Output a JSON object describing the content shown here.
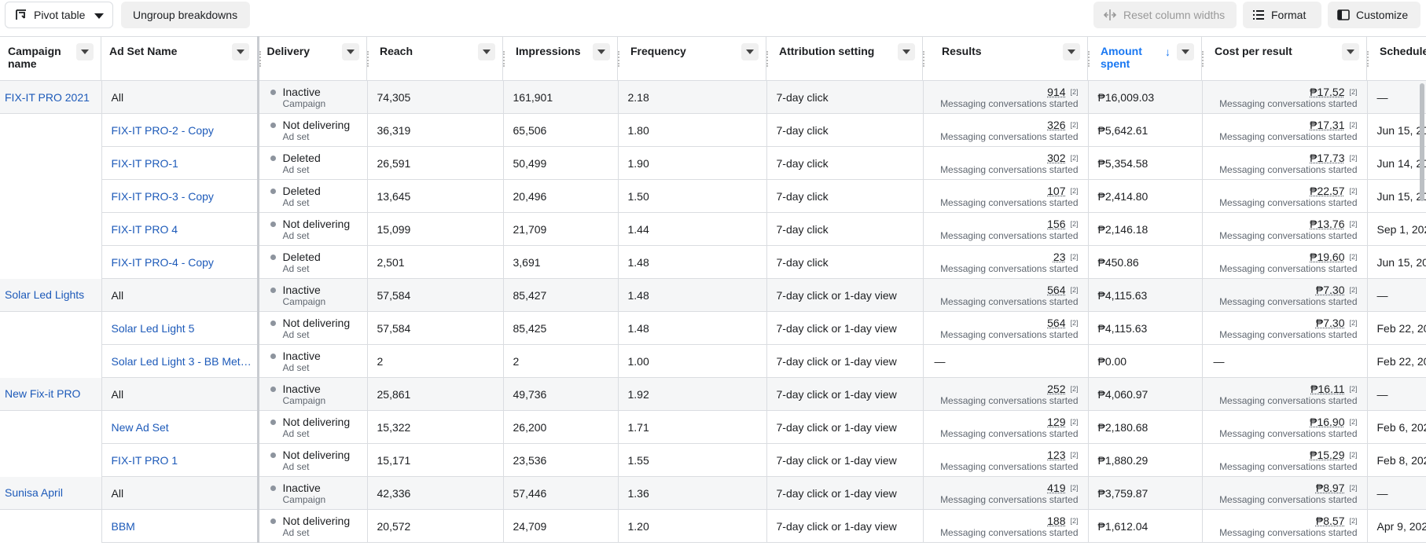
{
  "toolbar": {
    "pivot_label": "Pivot table",
    "ungroup_label": "Ungroup breakdowns",
    "reset_label": "Reset column widths",
    "format_label": "Format",
    "customize_label": "Customize"
  },
  "columns": {
    "campaign": "Campaign name",
    "adset": "Ad Set Name",
    "delivery": "Delivery",
    "reach": "Reach",
    "impressions": "Impressions",
    "frequency": "Frequency",
    "attribution": "Attribution setting",
    "results": "Results",
    "amount": "Amount spent",
    "cpr": "Cost per result",
    "schedule": "Schedule"
  },
  "footnote": "[2]",
  "rows": [
    {
      "campaign": "FIX-IT PRO 2021",
      "adset": "All",
      "d1": "Inactive",
      "d2": "Campaign",
      "reach": "74,305",
      "impr": "161,901",
      "freq": "2.18",
      "attr": "7-day click",
      "res": "914",
      "res_sub": "Messaging conversations started",
      "amt": "₱16,009.03",
      "cpr": "₱17.52",
      "cpr_sub": "Messaging conversations started",
      "sched": "—"
    },
    {
      "campaign": "",
      "adset": "FIX-IT PRO-2 - Copy",
      "d1": "Not delivering",
      "d2": "Ad set",
      "reach": "36,319",
      "impr": "65,506",
      "freq": "1.80",
      "attr": "7-day click",
      "res": "326",
      "res_sub": "Messaging conversations started",
      "amt": "₱5,642.61",
      "cpr": "₱17.31",
      "cpr_sub": "Messaging conversations started",
      "sched": "Jun 15, 20"
    },
    {
      "campaign": "",
      "adset": "FIX-IT PRO-1",
      "d1": "Deleted",
      "d2": "Ad set",
      "reach": "26,591",
      "impr": "50,499",
      "freq": "1.90",
      "attr": "7-day click",
      "res": "302",
      "res_sub": "Messaging conversations started",
      "amt": "₱5,354.58",
      "cpr": "₱17.73",
      "cpr_sub": "Messaging conversations started",
      "sched": "Jun 14, 20"
    },
    {
      "campaign": "",
      "adset": "FIX-IT PRO-3 - Copy",
      "d1": "Deleted",
      "d2": "Ad set",
      "reach": "13,645",
      "impr": "20,496",
      "freq": "1.50",
      "attr": "7-day click",
      "res": "107",
      "res_sub": "Messaging conversations started",
      "amt": "₱2,414.80",
      "cpr": "₱22.57",
      "cpr_sub": "Messaging conversations started",
      "sched": "Jun 15, 20"
    },
    {
      "campaign": "",
      "adset": "FIX-IT PRO 4",
      "d1": "Not delivering",
      "d2": "Ad set",
      "reach": "15,099",
      "impr": "21,709",
      "freq": "1.44",
      "attr": "7-day click",
      "res": "156",
      "res_sub": "Messaging conversations started",
      "amt": "₱2,146.18",
      "cpr": "₱13.76",
      "cpr_sub": "Messaging conversations started",
      "sched": "Sep 1, 202"
    },
    {
      "campaign": "",
      "adset": "FIX-IT PRO-4 - Copy",
      "d1": "Deleted",
      "d2": "Ad set",
      "reach": "2,501",
      "impr": "3,691",
      "freq": "1.48",
      "attr": "7-day click",
      "res": "23",
      "res_sub": "Messaging conversations started",
      "amt": "₱450.86",
      "cpr": "₱19.60",
      "cpr_sub": "Messaging conversations started",
      "sched": "Jun 15, 20"
    },
    {
      "campaign": "Solar Led Lights",
      "adset": "All",
      "d1": "Inactive",
      "d2": "Campaign",
      "reach": "57,584",
      "impr": "85,427",
      "freq": "1.48",
      "attr": "7-day click or 1-day view",
      "res": "564",
      "res_sub": "Messaging conversations started",
      "amt": "₱4,115.63",
      "cpr": "₱7.30",
      "cpr_sub": "Messaging conversations started",
      "sched": "—"
    },
    {
      "campaign": "",
      "adset": "Solar Led Light 5",
      "d1": "Not delivering",
      "d2": "Ad set",
      "reach": "57,584",
      "impr": "85,425",
      "freq": "1.48",
      "attr": "7-day click or 1-day view",
      "res": "564",
      "res_sub": "Messaging conversations started",
      "amt": "₱4,115.63",
      "cpr": "₱7.30",
      "cpr_sub": "Messaging conversations started",
      "sched": "Feb 22, 20"
    },
    {
      "campaign": "",
      "adset": "Solar Led Light 3 - BB Met…",
      "d1": "Inactive",
      "d2": "Ad set",
      "reach": "2",
      "impr": "2",
      "freq": "1.00",
      "attr": "7-day click or 1-day view",
      "res": "",
      "res_sub": "",
      "amt": "₱0.00",
      "cpr": "",
      "cpr_sub": "",
      "sched": "Feb 22, 20"
    },
    {
      "campaign": "New Fix-it PRO",
      "adset": "All",
      "d1": "Inactive",
      "d2": "Campaign",
      "reach": "25,861",
      "impr": "49,736",
      "freq": "1.92",
      "attr": "7-day click or 1-day view",
      "res": "252",
      "res_sub": "Messaging conversations started",
      "amt": "₱4,060.97",
      "cpr": "₱16.11",
      "cpr_sub": "Messaging conversations started",
      "sched": "—"
    },
    {
      "campaign": "",
      "adset": "New Ad Set",
      "d1": "Not delivering",
      "d2": "Ad set",
      "reach": "15,322",
      "impr": "26,200",
      "freq": "1.71",
      "attr": "7-day click or 1-day view",
      "res": "129",
      "res_sub": "Messaging conversations started",
      "amt": "₱2,180.68",
      "cpr": "₱16.90",
      "cpr_sub": "Messaging conversations started",
      "sched": "Feb 6, 202"
    },
    {
      "campaign": "",
      "adset": "FIX-IT PRO 1",
      "d1": "Not delivering",
      "d2": "Ad set",
      "reach": "15,171",
      "impr": "23,536",
      "freq": "1.55",
      "attr": "7-day click or 1-day view",
      "res": "123",
      "res_sub": "Messaging conversations started",
      "amt": "₱1,880.29",
      "cpr": "₱15.29",
      "cpr_sub": "Messaging conversations started",
      "sched": "Feb 8, 202"
    },
    {
      "campaign": "Sunisa April",
      "adset": "All",
      "d1": "Inactive",
      "d2": "Campaign",
      "reach": "42,336",
      "impr": "57,446",
      "freq": "1.36",
      "attr": "7-day click or 1-day view",
      "res": "419",
      "res_sub": "Messaging conversations started",
      "amt": "₱3,759.87",
      "cpr": "₱8.97",
      "cpr_sub": "Messaging conversations started",
      "sched": "—"
    },
    {
      "campaign": "",
      "adset": "BBM",
      "d1": "Not delivering",
      "d2": "Ad set",
      "reach": "20,572",
      "impr": "24,709",
      "freq": "1.20",
      "attr": "7-day click or 1-day view",
      "res": "188",
      "res_sub": "Messaging conversations started",
      "amt": "₱1,612.04",
      "cpr": "₱8.57",
      "cpr_sub": "Messaging conversations started",
      "sched": "Apr 9, 202"
    }
  ],
  "empty_dash": "—"
}
